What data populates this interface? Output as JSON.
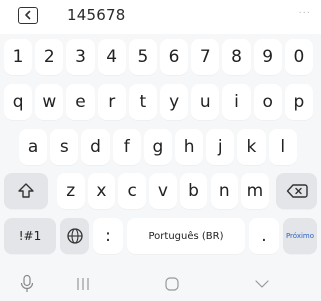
{
  "suggestion_bar": {
    "back_icon": "back-icon",
    "text": "145678",
    "more": "···"
  },
  "keyboard": {
    "row_numbers": [
      "1",
      "2",
      "3",
      "4",
      "5",
      "6",
      "7",
      "8",
      "9",
      "0"
    ],
    "row_q": [
      "q",
      "w",
      "e",
      "r",
      "t",
      "y",
      "u",
      "i",
      "o",
      "p"
    ],
    "row_a": [
      "a",
      "s",
      "d",
      "f",
      "g",
      "h",
      "j",
      "k",
      "l"
    ],
    "row_z": [
      "z",
      "x",
      "c",
      "v",
      "b",
      "n",
      "m"
    ],
    "shift_icon": "shift-icon",
    "backspace_icon": "backspace-icon",
    "symbols_label": "!#1",
    "globe_icon": "globe-icon",
    "colon_label": ":",
    "space_label": "Português (BR)",
    "period_label": ".",
    "next_label": "Próximo",
    "accent_color": "#2b63c6"
  },
  "nav_bar": {
    "mic_icon": "microphone-icon",
    "recents_icon": "recents-icon",
    "home_icon": "home-icon",
    "hide_keyboard_icon": "chevron-down-icon"
  }
}
